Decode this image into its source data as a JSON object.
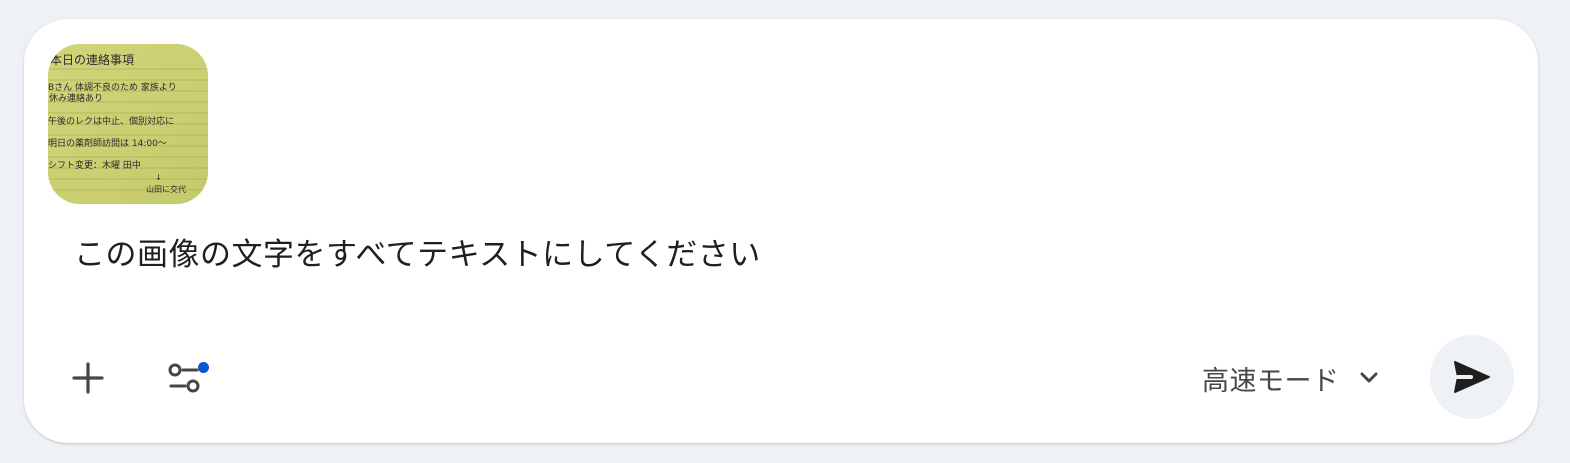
{
  "composer": {
    "prompt_text": "この画像の文字をすべてテキストにしてください",
    "attachment": {
      "lines": [
        "本日の連絡事項",
        "Bさん 体調不良のため 家族より",
        "休み連絡あり",
        "午後のレクは中止、個別対応に",
        "明日の薬剤師訪問は 14:00〜",
        "シフト変更：木曜 田中",
        "↓",
        "山田に交代"
      ]
    },
    "mode": {
      "label": "高速モード"
    },
    "icons": {
      "add": "plus-icon",
      "tools": "tune-icon",
      "mode_chevron": "chevron-down-icon",
      "send": "send-icon"
    },
    "colors": {
      "page_background": "#eef1f6",
      "composer_background": "#ffffff",
      "note_paper": "#cfd374",
      "accent_dot": "#0b57d0",
      "send_button_bg": "#eef1f6"
    }
  }
}
